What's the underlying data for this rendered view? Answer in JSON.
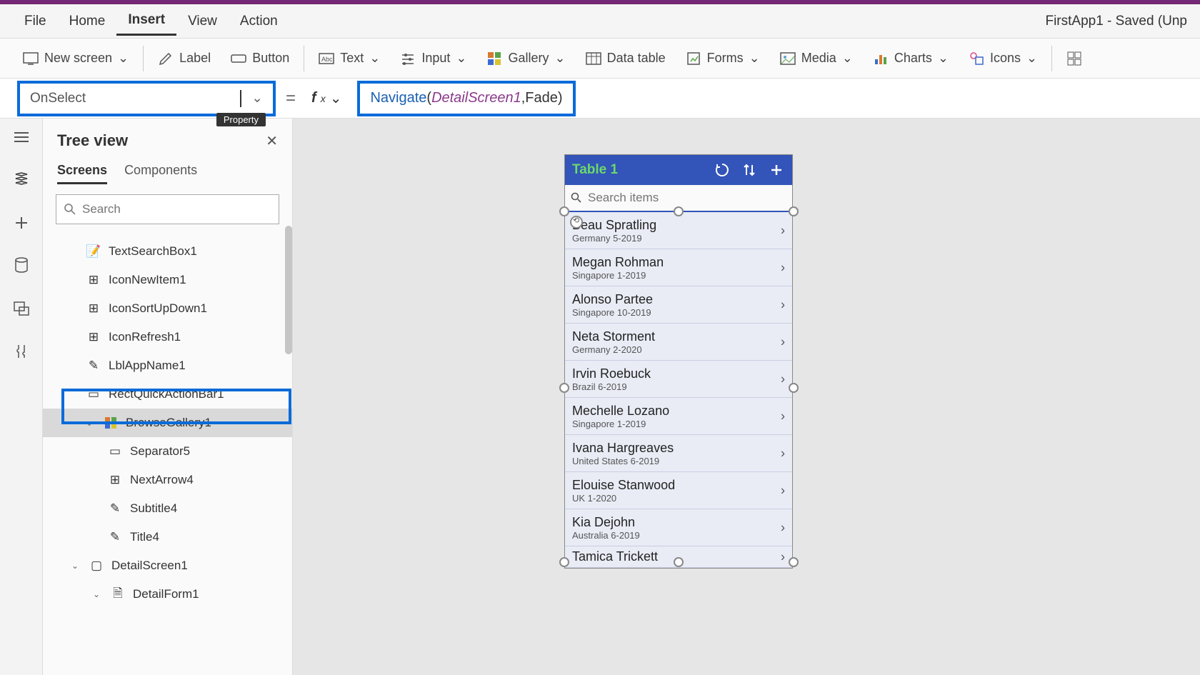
{
  "app": {
    "title": "FirstApp1 - Saved (Unp"
  },
  "menu": {
    "file": "File",
    "home": "Home",
    "insert": "Insert",
    "view": "View",
    "action": "Action"
  },
  "ribbon": {
    "new_screen": "New screen",
    "label": "Label",
    "button": "Button",
    "text": "Text",
    "input": "Input",
    "gallery": "Gallery",
    "data_table": "Data table",
    "forms": "Forms",
    "media": "Media",
    "charts": "Charts",
    "icons": "Icons"
  },
  "formula": {
    "property": "OnSelect",
    "tooltip": "Property",
    "fn": "Navigate",
    "arg1": "DetailScreen1",
    "arg2": "Fade"
  },
  "tree": {
    "title": "Tree view",
    "tabs": {
      "screens": "Screens",
      "components": "Components"
    },
    "search_placeholder": "Search",
    "nodes": {
      "textsearch": "TextSearchBox1",
      "iconnew": "IconNewItem1",
      "iconsort": "IconSortUpDown1",
      "iconrefresh": "IconRefresh1",
      "lblapp": "LblAppName1",
      "rectquick": "RectQuickActionBar1",
      "browsegallery": "BrowseGallery1",
      "separator": "Separator5",
      "nextarrow": "NextArrow4",
      "subtitle": "Subtitle4",
      "title": "Title4",
      "detailscreen": "DetailScreen1",
      "detailform": "DetailForm1"
    }
  },
  "phone": {
    "header_title": "Table 1",
    "search_placeholder": "Search items",
    "items": [
      {
        "name": "Beau Spratling",
        "sub": "Germany 5-2019"
      },
      {
        "name": "Megan Rohman",
        "sub": "Singapore 1-2019"
      },
      {
        "name": "Alonso Partee",
        "sub": "Singapore 10-2019"
      },
      {
        "name": "Neta Storment",
        "sub": "Germany 2-2020"
      },
      {
        "name": "Irvin Roebuck",
        "sub": "Brazil 6-2019"
      },
      {
        "name": "Mechelle Lozano",
        "sub": "Singapore 1-2019"
      },
      {
        "name": "Ivana Hargreaves",
        "sub": "United States 6-2019"
      },
      {
        "name": "Elouise Stanwood",
        "sub": "UK 1-2020"
      },
      {
        "name": "Kia Dejohn",
        "sub": "Australia 6-2019"
      },
      {
        "name": "Tamica Trickett",
        "sub": ""
      }
    ]
  }
}
